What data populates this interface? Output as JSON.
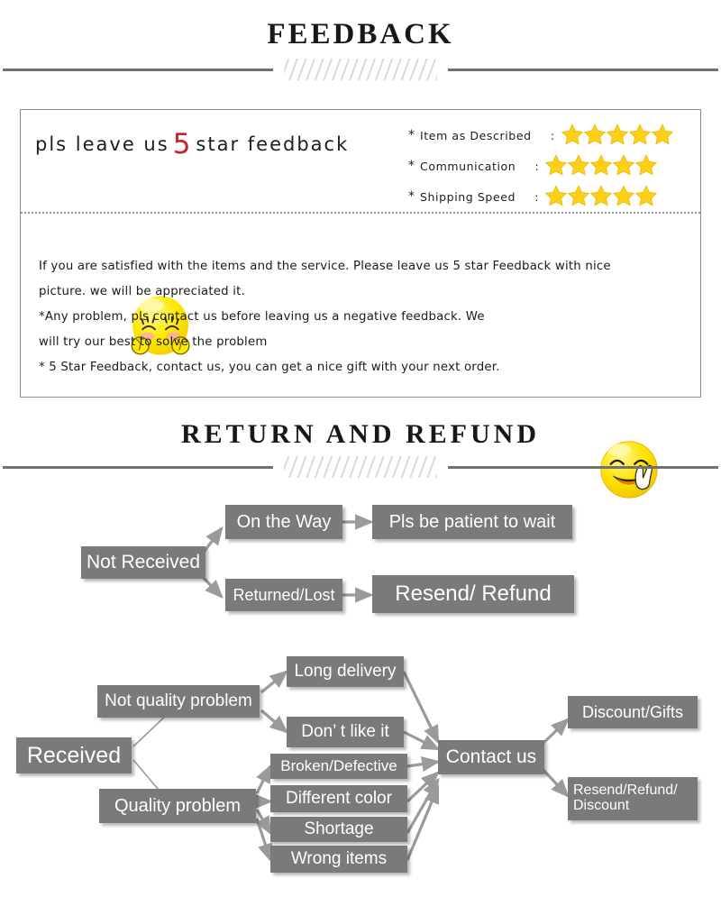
{
  "sections": {
    "feedback": {
      "title": "FEEDBACK"
    },
    "return": {
      "title": "RETURN AND REFUND"
    }
  },
  "feedback_panel": {
    "headline_pre": "pls leave us",
    "headline_number": "5",
    "headline_post": "star feedback",
    "ratings": [
      {
        "asterisk": "*",
        "label": "Item as Described",
        "colon": ":",
        "stars": 5
      },
      {
        "asterisk": "*",
        "label": "Communication",
        "colon": ":",
        "stars": 5
      },
      {
        "asterisk": "*",
        "label": "Shipping Speed",
        "colon": ":",
        "stars": 5
      }
    ],
    "body_lines": [
      "If you are satisfied with the items and the service. Please leave us 5 star Feedback with nice",
      "picture. we will be appreciated it.",
      "*Any problem, pls contact us before leaving us a negative feedback. We",
      "will try our best to solve  the problem",
      "* 5 Star Feedback, contact us, you can get a nice gift with your next order."
    ],
    "emoji_left_name": "shy-blushing-face-emoji",
    "emoji_right_name": "smiling-face-peace-hand-emoji"
  },
  "flowchart": {
    "nodes": {
      "not_received": "Not Received",
      "on_the_way": "On the Way",
      "pls_be_patient": "Pls be patient to wait",
      "returned_lost": "Returned/Lost",
      "resend_refund": "Resend/ Refund",
      "received": "Received",
      "not_quality": "Not quality problem",
      "quality_problem": "Quality problem",
      "long_delivery": "Long delivery",
      "dont_like_it": "Don’ t like it",
      "broken_defective": "Broken/Defective",
      "different_color": "Different color",
      "shortage": "Shortage",
      "wrong_items": "Wrong items",
      "contact_us": "Contact us",
      "discount_gifts": "Discount/Gifts",
      "resend_refund_discount_l1": "Resend/Refund/",
      "resend_refund_discount_l2": "Discount"
    }
  },
  "colors": {
    "node_fill": "#7a7a7a",
    "node_text": "#ffffff",
    "arrow": "#9a9a9a",
    "star": "#fdd017",
    "accent_red": "#c0242c",
    "rule": "#6f7173",
    "panel_border": "#8b8d8f",
    "dotted": "#8a93a8"
  }
}
